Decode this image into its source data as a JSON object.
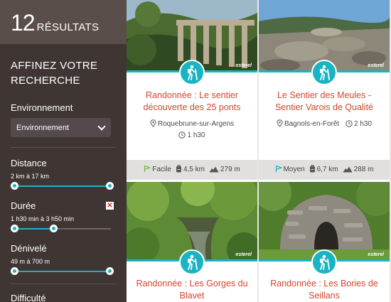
{
  "results": {
    "count": "12",
    "label": "RÉSULTATS"
  },
  "sidebar": {
    "refine_line1": "AFFINEZ VOTRE",
    "refine_line2": "RECHERCHE",
    "environment": {
      "title": "Environnement",
      "selected": "Environnement"
    },
    "distance": {
      "title": "Distance",
      "range": "2 km à 17 km",
      "low": 0,
      "high": 1
    },
    "duree": {
      "title": "Durée",
      "range": "1 h30 min à 3 h50 min",
      "low": 0,
      "high": 0.41
    },
    "denivele": {
      "title": "Dénivelé",
      "range": "49 m à 700 m",
      "low": 0,
      "high": 1
    },
    "difficulte": {
      "title": "Difficulté"
    }
  },
  "cards": [
    {
      "title_line1": "Randonnée : Le sentier",
      "title_line2": "découverte des 25 ponts",
      "location": "Roquebrune-sur-Argens",
      "duration": "1 h30",
      "difficulty": "Facile",
      "distance": "4,5 km",
      "elevation": "279 m",
      "watermark": "esterel",
      "difficulty_color": "#7ab648"
    },
    {
      "title_line1": "Le Sentier des Meules -",
      "title_line2": "Sentier Varois de Qualité",
      "location": "Bagnols-en-Forêt",
      "duration": "2 h30",
      "difficulty": "Moyen",
      "distance": "6,7 km",
      "elevation": "288 m",
      "watermark": "esterel",
      "difficulty_color": "#19b4c4"
    },
    {
      "title_line1": "Randonnée : Les Gorges du",
      "title_line2": "Blavet",
      "watermark": "esterel"
    },
    {
      "title_line1": "Randonnée : Les Bories de",
      "title_line2": "Seillans",
      "watermark": "esterel"
    }
  ],
  "colors": {
    "accent": "#19b4c4",
    "title_red": "#d4452f",
    "sidebar_bg": "#3f3633"
  }
}
